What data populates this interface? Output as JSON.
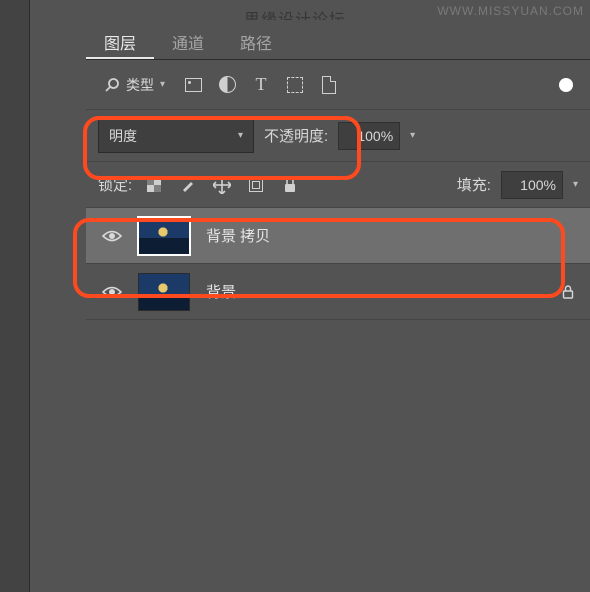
{
  "watermark_right": "WWW.MISSYUAN.COM",
  "watermark_center": "思缘设计论坛",
  "tabs": {
    "layers": "图层",
    "channels": "通道",
    "paths": "路径"
  },
  "filter": {
    "type_label": "类型"
  },
  "blend": {
    "mode": "明度",
    "opacity_label": "不透明度:",
    "opacity_value": "100%"
  },
  "lock": {
    "label": "锁定:",
    "fill_label": "填充:",
    "fill_value": "100%"
  },
  "layers": [
    {
      "name": "背景 拷贝",
      "selected": true,
      "locked": false
    },
    {
      "name": "背景",
      "selected": false,
      "locked": true
    }
  ]
}
